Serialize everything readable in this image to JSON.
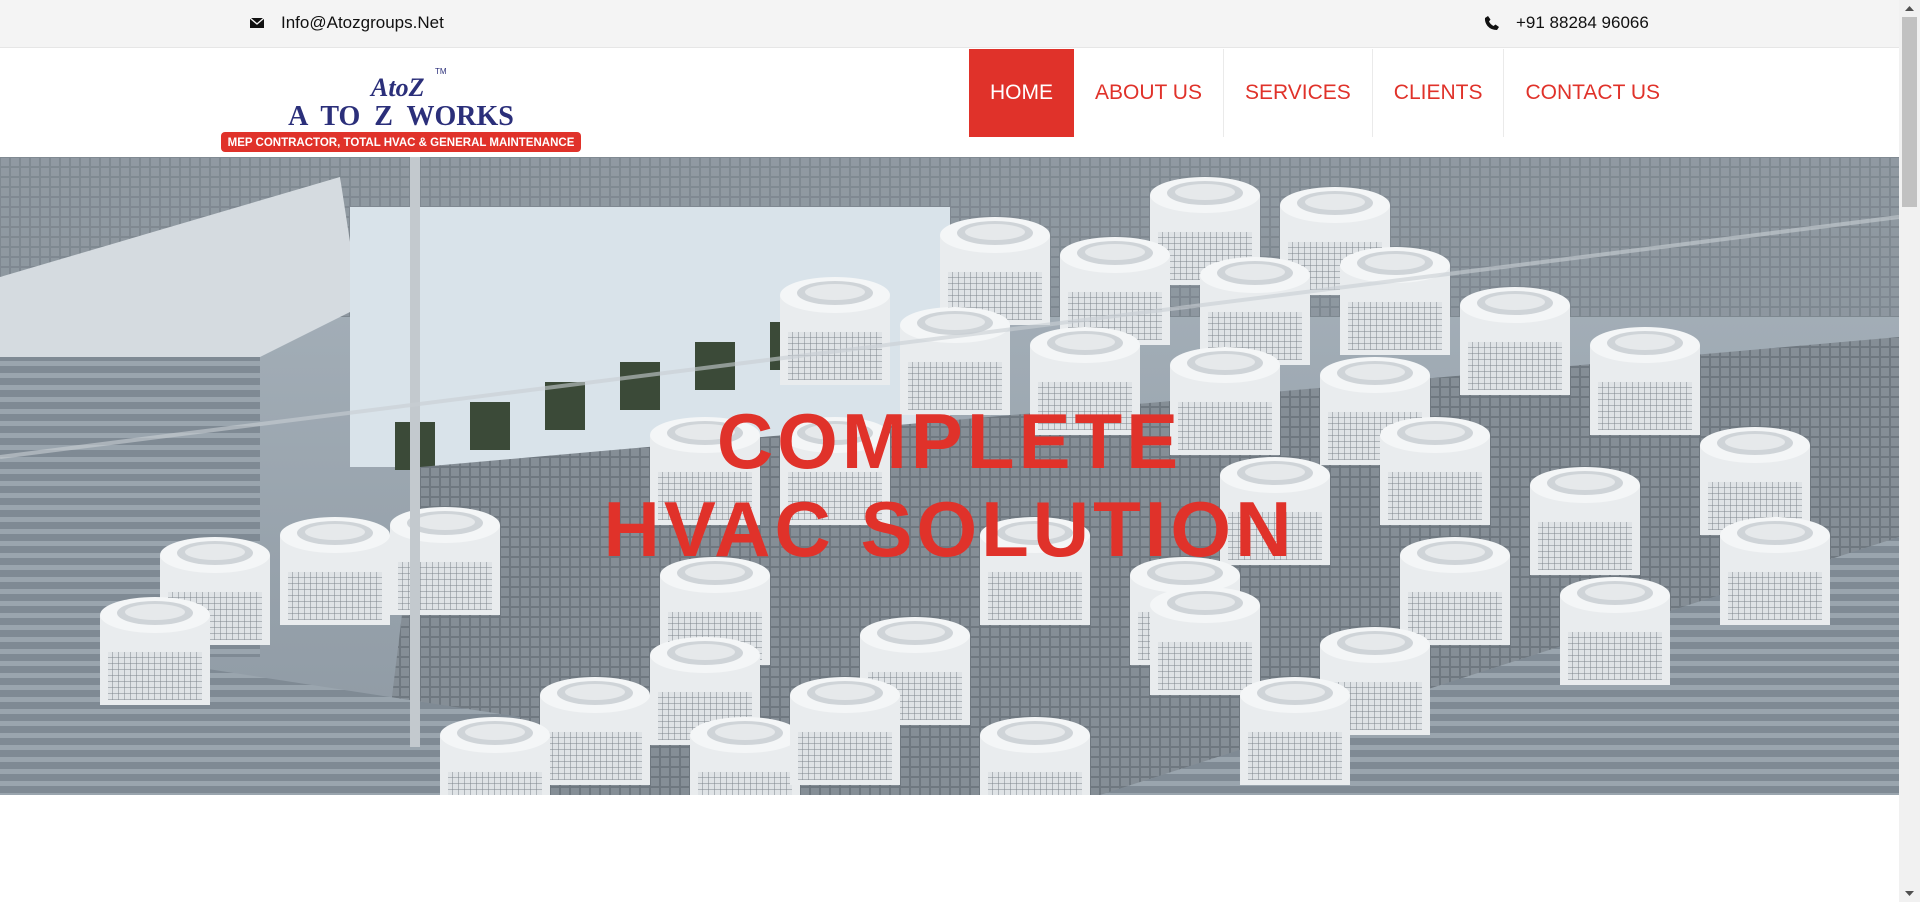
{
  "topbar": {
    "email": "Info@Atozgroups.Net",
    "phone": "+91 88284 96066",
    "email_icon": "envelope-icon",
    "phone_icon": "phone-icon"
  },
  "logo": {
    "mark": "AtoZ",
    "tm": "TM",
    "name": "A  TO  Z  WORKS",
    "tagline": "MEP CONTRACTOR, TOTAL HVAC & GENERAL MAINTENANCE"
  },
  "nav": {
    "items": [
      {
        "label": "HOME",
        "active": true
      },
      {
        "label": "ABOUT US",
        "active": false
      },
      {
        "label": "SERVICES",
        "active": false
      },
      {
        "label": "CLIENTS",
        "active": false
      },
      {
        "label": "CONTACT US",
        "active": false
      }
    ]
  },
  "hero": {
    "line1": "COMPLETE",
    "line2": "HVAC SOLUTION"
  },
  "colors": {
    "accent": "#e0322a",
    "logo_blue": "#2b2f7a",
    "topbar_bg": "#f4f4f4"
  }
}
